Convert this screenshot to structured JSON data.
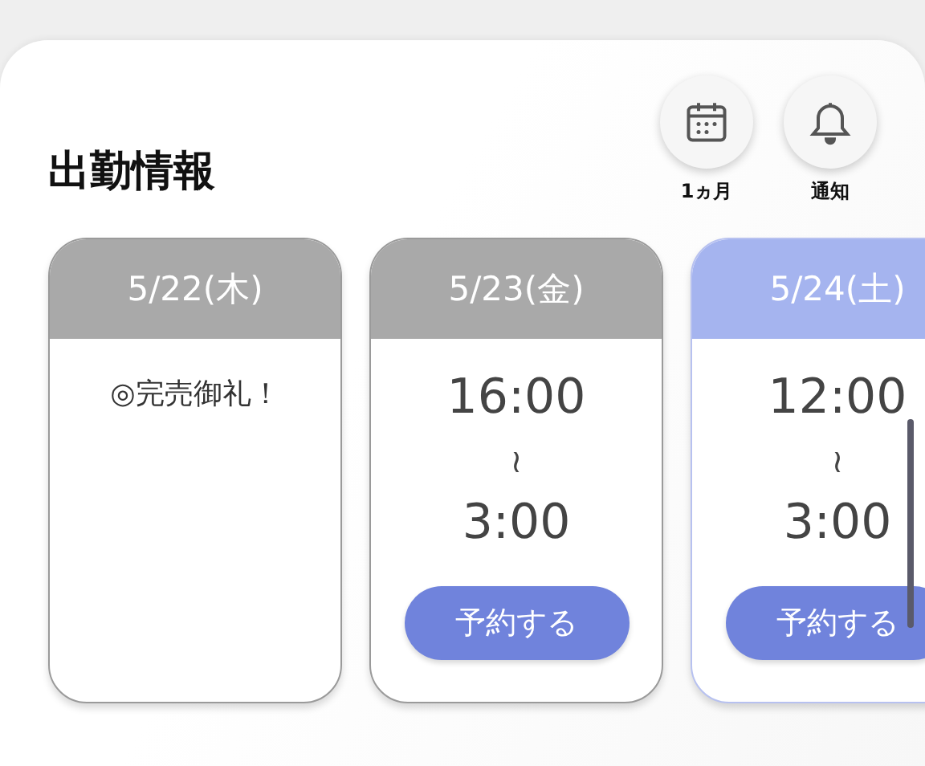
{
  "title": "出勤情報",
  "actions": [
    {
      "kind": "calendar",
      "label": "1ヵ月"
    },
    {
      "kind": "bell",
      "label": "通知"
    }
  ],
  "days": [
    {
      "date": "5/22(木)",
      "selected": false,
      "kind": "message",
      "message": "◎完売御礼！"
    },
    {
      "date": "5/23(金)",
      "selected": false,
      "kind": "shift",
      "start": "16:00",
      "separator": "≀",
      "end": "3:00",
      "button": "予約する"
    },
    {
      "date": "5/24(土)",
      "selected": true,
      "kind": "shift",
      "start": "12:00",
      "separator": "≀",
      "end": "3:00",
      "button": "予約する"
    }
  ]
}
